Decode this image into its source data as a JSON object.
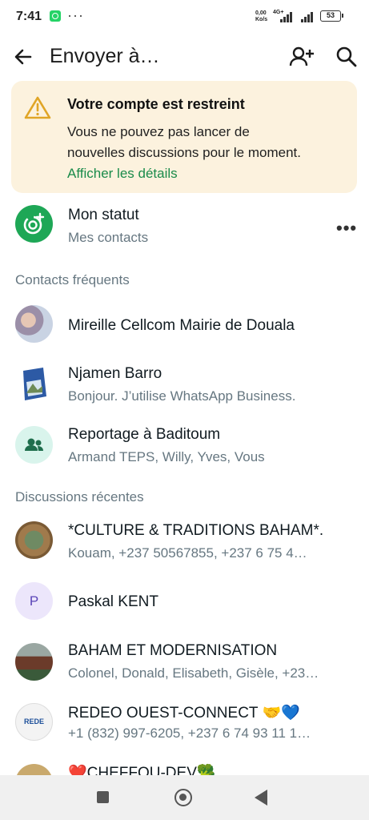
{
  "status_bar": {
    "time": "7:41",
    "dots": "···",
    "speed_value": "0,00",
    "speed_unit": "Ko/s",
    "network": "4G+",
    "battery": "53"
  },
  "header": {
    "title": "Envoyer à…"
  },
  "banner": {
    "title": "Votre compte est restreint",
    "text": "Vous ne pouvez pas lancer de nouvelles discussions pour le moment. ",
    "link": "Afficher les détails"
  },
  "status_row": {
    "name": "Mon statut",
    "sub": "Mes contacts"
  },
  "sections": {
    "frequent": "Contacts fréquents",
    "recent": "Discussions récentes"
  },
  "frequent_contacts": [
    {
      "name": "Mireille Cellcom Mairie de Douala",
      "sub": ""
    },
    {
      "name": "Njamen Barro",
      "sub": "Bonjour. J’utilise WhatsApp Business."
    },
    {
      "name": "Reportage à Baditoum",
      "sub": "Armand TEPS, Willy, Yves, Vous"
    }
  ],
  "recent_chats": [
    {
      "name": "*CULTURE & TRADITIONS BAHAM*.",
      "sub": "Kouam, +237 50567855, +237 6 75 4…"
    },
    {
      "name": "Paskal KENT",
      "sub": "",
      "initial": "P"
    },
    {
      "name": "BAHAM ET MODERNISATION",
      "sub": "Colonel, Donald, Elisabeth, Gisèle, +23…"
    },
    {
      "name": "REDEO OUEST-CONNECT 🤝💙",
      "sub": "+1 (832) 997-6205, +237 6 74 93 11 1…",
      "avatar_text": "REDE"
    },
    {
      "name": "❤️CHEFFOU-DEV🥦",
      "sub": ""
    }
  ],
  "colors": {
    "accent": "#25d366",
    "link": "#1a8b4a",
    "banner_bg": "#fcf2de",
    "secondary_text": "#667781"
  }
}
